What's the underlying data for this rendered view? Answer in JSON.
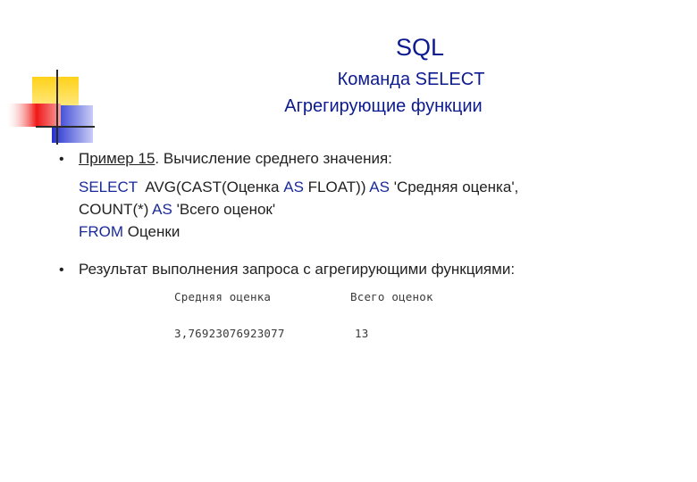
{
  "title": {
    "main": "SQL",
    "sub1": "Команда SELECT",
    "sub2": "Агрегирующие функции"
  },
  "bullet1": {
    "link": "Пример 15",
    "text": ". Вычисление среднего значения:"
  },
  "code": {
    "line1": {
      "kw1": "SELECT",
      "t1": "  AVG(CAST(Оценка ",
      "kw2": "AS",
      "t2": " FLOAT)) ",
      "kw3": "AS",
      "t3": " 'Средняя оценка',"
    },
    "line2": {
      "t1": "COUNT(*) ",
      "kw1": "AS",
      "t2": " 'Всего оценок'"
    },
    "line3": {
      "kw1": "FROM",
      "t1": " Оценки"
    }
  },
  "bullet2": {
    "text": "Результат выполнения запроса с агрегирующими функциями:"
  },
  "result_table": {
    "headers": [
      "Средняя оценка",
      "Всего оценок"
    ],
    "row": [
      "3,76923076923077",
      "13"
    ]
  },
  "colors": {
    "title": "#0c1a8f",
    "keyword": "#1a2a9a",
    "decor_yellow": "#ffd21a",
    "decor_red": "#f01818",
    "decor_blue": "#2430d0",
    "decor_lines": "#2a2a2a"
  }
}
